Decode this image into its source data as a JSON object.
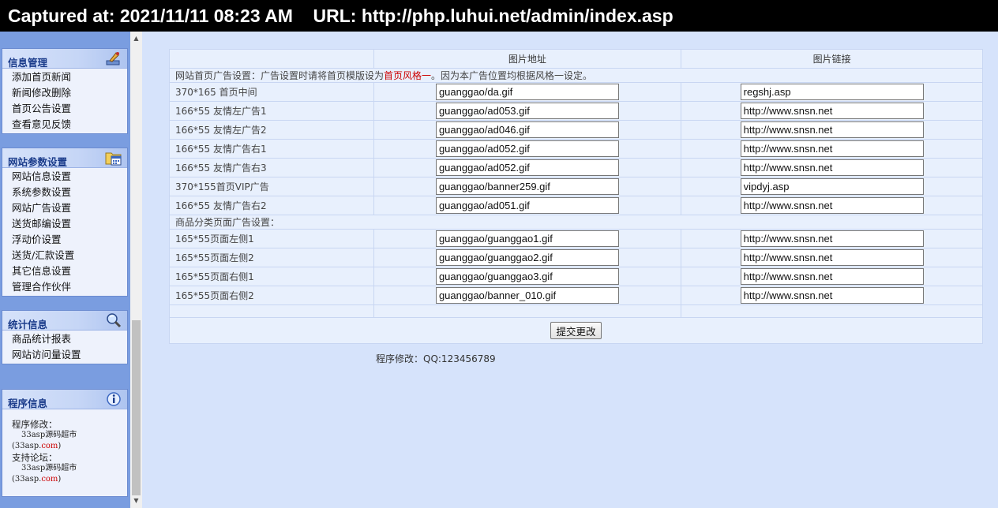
{
  "capture_bar": {
    "text": "Captured at: 2021/11/11 08:23 AM    URL: http://php.luhui.net/admin/index.asp"
  },
  "sidebar": {
    "info_mgmt": {
      "title": "信息管理",
      "items": [
        "添加首页新闻",
        "新闻修改删除",
        "首页公告设置",
        "查看意见反馈"
      ]
    },
    "site_params": {
      "title": "网站参数设置",
      "items": [
        "网站信息设置",
        "系统参数设置",
        "网站广告设置",
        "送货邮编设置",
        "浮动价设置",
        "送货/汇款设置",
        "其它信息设置",
        "管理合作伙伴"
      ]
    },
    "stats": {
      "title": "统计信息",
      "items": [
        "商品统计报表",
        "网站访问量设置"
      ]
    },
    "program_info": {
      "title": "程序信息",
      "mod_label": "程序修改：",
      "mod_name": "33asp源码超市",
      "mod_site_prefix": "(33asp.",
      "mod_site_suffix": "com",
      "mod_site_end": ")",
      "forum_label": "支持论坛：",
      "forum_name": "33asp源码超市",
      "forum_site_prefix": "(33asp.",
      "forum_site_suffix": "com",
      "forum_site_end": ")"
    }
  },
  "table": {
    "header_col2": "图片地址",
    "header_col3": "图片链接",
    "note1_prefix": "网站首页广告设置：广告设置时请将首页模版设为",
    "note1_highlight": "首页风格一",
    "note1_suffix": "。因为本广告位置均根据风格一设定。",
    "section1": [
      {
        "label": "370*165 首页中间",
        "image": "guanggao/da.gif",
        "link": "regshj.asp"
      },
      {
        "label": "166*55 友情左广告1",
        "image": "guanggao/ad053.gif",
        "link": "http://www.snsn.net"
      },
      {
        "label": "166*55 友情左广告2",
        "image": "guanggao/ad046.gif",
        "link": "http://www.snsn.net"
      },
      {
        "label": "166*55 友情广告右1",
        "image": "guanggao/ad052.gif",
        "link": "http://www.snsn.net"
      },
      {
        "label": "166*55 友情广告右3",
        "image": "guanggao/ad052.gif",
        "link": "http://www.snsn.net"
      },
      {
        "label": "370*155首页VIP广告",
        "image": "guanggao/banner259.gif",
        "link": "vipdyj.asp"
      },
      {
        "label": "166*55 友情广告右2",
        "image": "guanggao/ad051.gif",
        "link": "http://www.snsn.net"
      }
    ],
    "note2": "商品分类页面广告设置：",
    "section2": [
      {
        "label": "165*55页面左侧1",
        "image": "guanggao/guanggao1.gif",
        "link": "http://www.snsn.net"
      },
      {
        "label": "165*55页面左侧2",
        "image": "guanggao/guanggao2.gif",
        "link": "http://www.snsn.net"
      },
      {
        "label": "165*55页面右侧1",
        "image": "guanggao/guanggao3.gif",
        "link": "http://www.snsn.net"
      },
      {
        "label": "165*55页面右侧2",
        "image": "guanggao/banner_010.gif",
        "link": "http://www.snsn.net"
      }
    ],
    "submit_label": "提交更改"
  },
  "footer": {
    "text": "程序修改：QQ:123456789"
  },
  "icons": {
    "info_mgmt": "pen-tool-icon",
    "site_params": "calendar-folder-icon",
    "stats": "magnifier-icon",
    "program_info": "info-icon",
    "scroll_up": "arrow-up-icon",
    "scroll_down": "arrow-down-icon"
  },
  "colors": {
    "sidebar_bg": "#7a9de0",
    "page_bg": "#d6e3fb",
    "title_text": "#1a3b8a",
    "highlight": "#cc0000"
  }
}
